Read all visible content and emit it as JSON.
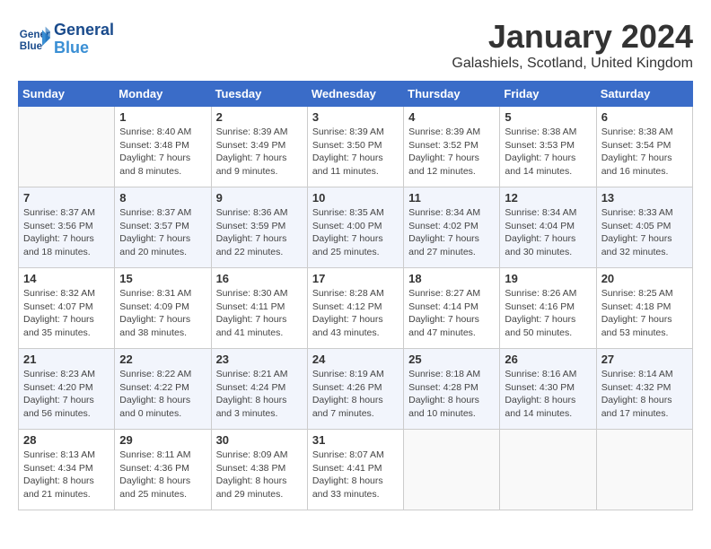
{
  "header": {
    "logo_line1": "General",
    "logo_line2": "Blue",
    "month": "January 2024",
    "location": "Galashiels, Scotland, United Kingdom"
  },
  "weekdays": [
    "Sunday",
    "Monday",
    "Tuesday",
    "Wednesday",
    "Thursday",
    "Friday",
    "Saturday"
  ],
  "weeks": [
    [
      {
        "day": "",
        "info": ""
      },
      {
        "day": "1",
        "info": "Sunrise: 8:40 AM\nSunset: 3:48 PM\nDaylight: 7 hours\nand 8 minutes."
      },
      {
        "day": "2",
        "info": "Sunrise: 8:39 AM\nSunset: 3:49 PM\nDaylight: 7 hours\nand 9 minutes."
      },
      {
        "day": "3",
        "info": "Sunrise: 8:39 AM\nSunset: 3:50 PM\nDaylight: 7 hours\nand 11 minutes."
      },
      {
        "day": "4",
        "info": "Sunrise: 8:39 AM\nSunset: 3:52 PM\nDaylight: 7 hours\nand 12 minutes."
      },
      {
        "day": "5",
        "info": "Sunrise: 8:38 AM\nSunset: 3:53 PM\nDaylight: 7 hours\nand 14 minutes."
      },
      {
        "day": "6",
        "info": "Sunrise: 8:38 AM\nSunset: 3:54 PM\nDaylight: 7 hours\nand 16 minutes."
      }
    ],
    [
      {
        "day": "7",
        "info": "Sunrise: 8:37 AM\nSunset: 3:56 PM\nDaylight: 7 hours\nand 18 minutes."
      },
      {
        "day": "8",
        "info": "Sunrise: 8:37 AM\nSunset: 3:57 PM\nDaylight: 7 hours\nand 20 minutes."
      },
      {
        "day": "9",
        "info": "Sunrise: 8:36 AM\nSunset: 3:59 PM\nDaylight: 7 hours\nand 22 minutes."
      },
      {
        "day": "10",
        "info": "Sunrise: 8:35 AM\nSunset: 4:00 PM\nDaylight: 7 hours\nand 25 minutes."
      },
      {
        "day": "11",
        "info": "Sunrise: 8:34 AM\nSunset: 4:02 PM\nDaylight: 7 hours\nand 27 minutes."
      },
      {
        "day": "12",
        "info": "Sunrise: 8:34 AM\nSunset: 4:04 PM\nDaylight: 7 hours\nand 30 minutes."
      },
      {
        "day": "13",
        "info": "Sunrise: 8:33 AM\nSunset: 4:05 PM\nDaylight: 7 hours\nand 32 minutes."
      }
    ],
    [
      {
        "day": "14",
        "info": "Sunrise: 8:32 AM\nSunset: 4:07 PM\nDaylight: 7 hours\nand 35 minutes."
      },
      {
        "day": "15",
        "info": "Sunrise: 8:31 AM\nSunset: 4:09 PM\nDaylight: 7 hours\nand 38 minutes."
      },
      {
        "day": "16",
        "info": "Sunrise: 8:30 AM\nSunset: 4:11 PM\nDaylight: 7 hours\nand 41 minutes."
      },
      {
        "day": "17",
        "info": "Sunrise: 8:28 AM\nSunset: 4:12 PM\nDaylight: 7 hours\nand 43 minutes."
      },
      {
        "day": "18",
        "info": "Sunrise: 8:27 AM\nSunset: 4:14 PM\nDaylight: 7 hours\nand 47 minutes."
      },
      {
        "day": "19",
        "info": "Sunrise: 8:26 AM\nSunset: 4:16 PM\nDaylight: 7 hours\nand 50 minutes."
      },
      {
        "day": "20",
        "info": "Sunrise: 8:25 AM\nSunset: 4:18 PM\nDaylight: 7 hours\nand 53 minutes."
      }
    ],
    [
      {
        "day": "21",
        "info": "Sunrise: 8:23 AM\nSunset: 4:20 PM\nDaylight: 7 hours\nand 56 minutes."
      },
      {
        "day": "22",
        "info": "Sunrise: 8:22 AM\nSunset: 4:22 PM\nDaylight: 8 hours\nand 0 minutes."
      },
      {
        "day": "23",
        "info": "Sunrise: 8:21 AM\nSunset: 4:24 PM\nDaylight: 8 hours\nand 3 minutes."
      },
      {
        "day": "24",
        "info": "Sunrise: 8:19 AM\nSunset: 4:26 PM\nDaylight: 8 hours\nand 7 minutes."
      },
      {
        "day": "25",
        "info": "Sunrise: 8:18 AM\nSunset: 4:28 PM\nDaylight: 8 hours\nand 10 minutes."
      },
      {
        "day": "26",
        "info": "Sunrise: 8:16 AM\nSunset: 4:30 PM\nDaylight: 8 hours\nand 14 minutes."
      },
      {
        "day": "27",
        "info": "Sunrise: 8:14 AM\nSunset: 4:32 PM\nDaylight: 8 hours\nand 17 minutes."
      }
    ],
    [
      {
        "day": "28",
        "info": "Sunrise: 8:13 AM\nSunset: 4:34 PM\nDaylight: 8 hours\nand 21 minutes."
      },
      {
        "day": "29",
        "info": "Sunrise: 8:11 AM\nSunset: 4:36 PM\nDaylight: 8 hours\nand 25 minutes."
      },
      {
        "day": "30",
        "info": "Sunrise: 8:09 AM\nSunset: 4:38 PM\nDaylight: 8 hours\nand 29 minutes."
      },
      {
        "day": "31",
        "info": "Sunrise: 8:07 AM\nSunset: 4:41 PM\nDaylight: 8 hours\nand 33 minutes."
      },
      {
        "day": "",
        "info": ""
      },
      {
        "day": "",
        "info": ""
      },
      {
        "day": "",
        "info": ""
      }
    ]
  ]
}
